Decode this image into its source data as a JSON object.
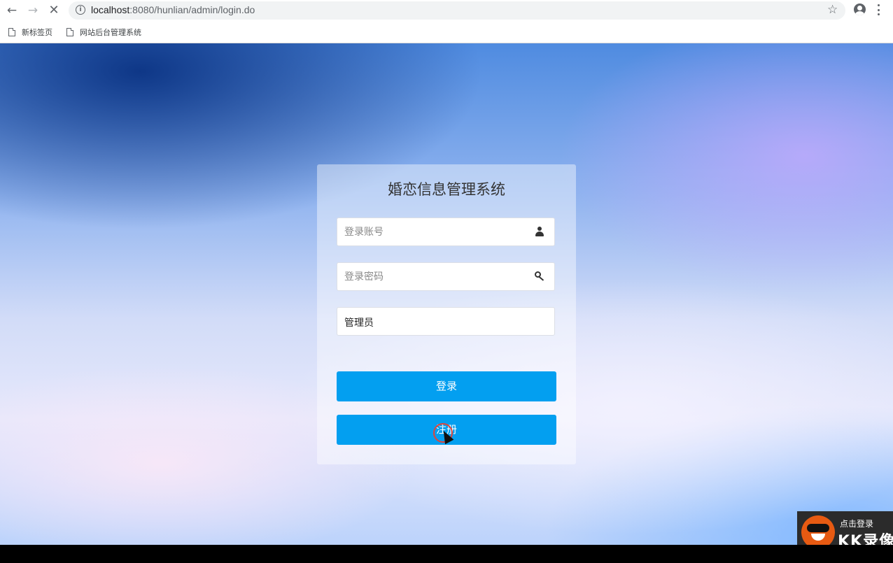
{
  "browser": {
    "url_host": "localhost",
    "url_path": ":8080/hunlian/admin/login.do",
    "icons": {
      "back": "back-arrow-icon",
      "forward": "forward-arrow-icon",
      "stop": "stop-loading-icon",
      "info": "site-info-icon",
      "star": "bookmark-star-icon",
      "account": "account-icon",
      "menu": "menu-dots-icon"
    },
    "bookmarks": [
      {
        "label": "新标签页"
      },
      {
        "label": "网站后台管理系统"
      }
    ]
  },
  "login": {
    "title": "婚恋信息管理系统",
    "account_placeholder": "登录账号",
    "password_placeholder": "登录密码",
    "role_value": "管理员",
    "login_button": "登录",
    "register_button": "注册"
  },
  "recorder": {
    "hint": "点击登录",
    "brand": "KK录像"
  },
  "colors": {
    "primary_button": "#039ff0",
    "bookmark_text": "#3c4043"
  }
}
